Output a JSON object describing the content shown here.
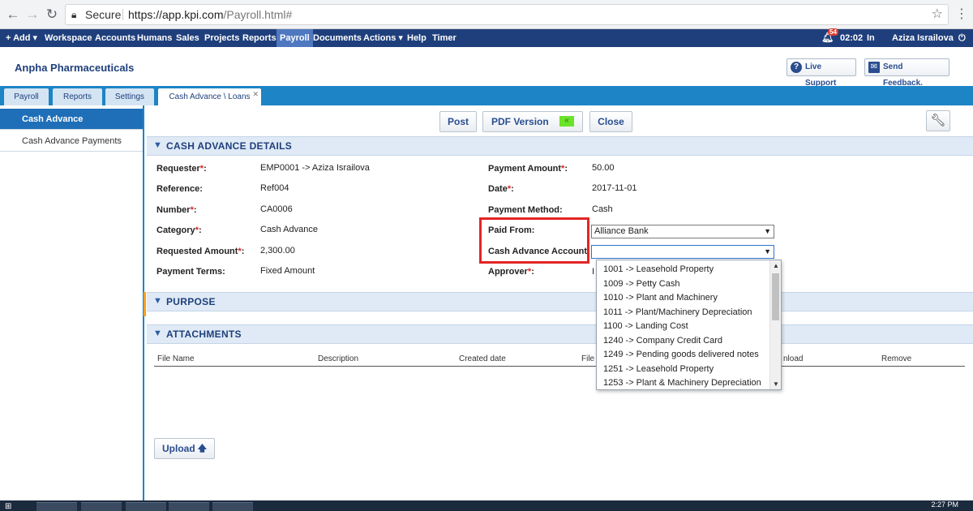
{
  "browser": {
    "secure_label": "Secure",
    "url_main": "https://app.kpi.com",
    "url_path": "/Payroll.html#"
  },
  "menubar": {
    "items": [
      "+ Add ▾",
      "Workspace",
      "Accounts",
      "Humans",
      "Sales",
      "Projects",
      "Reports",
      "Payroll",
      "Documents",
      "Actions ▾",
      "Help",
      "Timer"
    ],
    "active": "Payroll",
    "notification_count": "54",
    "time": "02:02",
    "status": "In",
    "user": "Aziza Israilova"
  },
  "header": {
    "company": "Anpha Pharmaceuticals",
    "live_support": "Live Support",
    "send_feedback": "Send Feedback."
  },
  "tabs": [
    "Payroll",
    "Reports",
    "Settings",
    "Cash Advance \\ Loans"
  ],
  "sidebar": [
    "Cash Advance",
    "Cash Advance Payments"
  ],
  "toolbar": {
    "post": "Post",
    "pdf": "PDF Version",
    "pdf_marker": "«",
    "close": "Close"
  },
  "sections": {
    "details": "CASH ADVANCE DETAILS",
    "purpose": "PURPOSE",
    "attachments": "ATTACHMENTS"
  },
  "form": {
    "requester_label": "Requester",
    "requester": "EMP0001 -> Aziza Israilova",
    "reference_label": "Reference:",
    "reference": "Ref004",
    "number_label": "Number",
    "number": "CA0006",
    "category_label": "Category",
    "category": "Cash Advance",
    "requested_amount_label": "Requested Amount",
    "requested_amount": "2,300.00",
    "payment_terms_label": "Payment Terms:",
    "payment_terms": "Fixed Amount",
    "payment_amount_label": "Payment Amount",
    "payment_amount": "50.00",
    "date_label": "Date",
    "date": "2017-11-01",
    "payment_method_label": "Payment Method:",
    "payment_method": "Cash",
    "paid_from_label": "Paid From:",
    "paid_from": "Alliance Bank",
    "cash_account_label": "Cash Advance Account:",
    "cash_account": "",
    "approver_label": "Approver",
    "approver_partial": "I"
  },
  "dropdown_options": [
    "1001 -> Leasehold Property",
    "1009 -> Petty Cash",
    "1010 -> Plant and Machinery",
    "1011 -> Plant/Machinery Depreciation",
    "1100 -> Landing Cost",
    "1240 -> Company Credit Card",
    "1249 -> Pending goods delivered notes",
    "1251 -> Leasehold Property",
    "1253 -> Plant & Machinery Depreciation"
  ],
  "attachments_table": {
    "columns": [
      "File Name",
      "Description",
      "Created date",
      "File",
      "nload",
      "Remove"
    ]
  },
  "upload_label": "Upload",
  "taskbar": {
    "clock": "2:27 PM"
  }
}
